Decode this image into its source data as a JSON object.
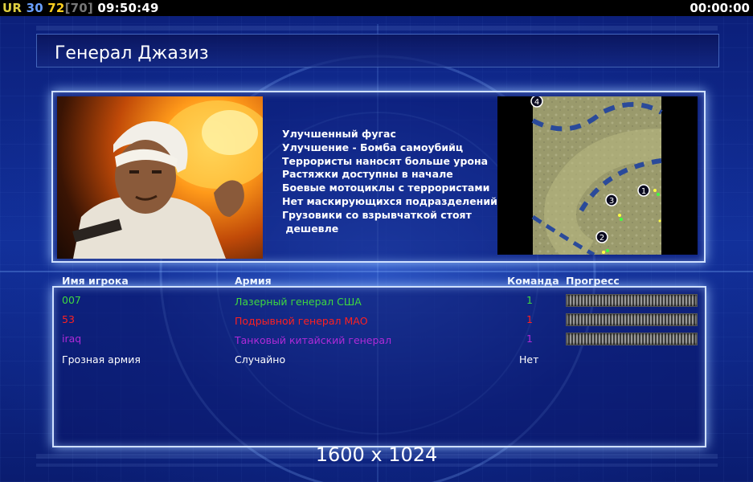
{
  "status_bar": {
    "ur": "UR",
    "ping": "30",
    "fps": "72",
    "fps_cap": "[70]",
    "clock": "09:50:49",
    "timer": "00:00:00"
  },
  "general": {
    "name": "Генерал Джазиз",
    "bonuses": [
      "Улучшенный фугас",
      "Улучшение - Бомба самоубийц",
      "Террористы наносят больше урона",
      "Растяжки доступны в начале",
      "Боевые мотоциклы с террористами",
      "Нет маскирующихся подразделений",
      "Грузовики со взрывчаткой стоят",
      " дешевле"
    ]
  },
  "minimap": {
    "markers": [
      "4",
      "1",
      "3",
      "2"
    ]
  },
  "table": {
    "headers": {
      "player": "Имя игрока",
      "army": "Армия",
      "team": "Команда",
      "progress": "Прогресс"
    },
    "rows": [
      {
        "player": "007",
        "army": "Лазерный генерал США",
        "team": "1",
        "color": "#3fd83f",
        "progress": 0
      },
      {
        "player": "53",
        "army": "Подрывной генерал МАО",
        "team": "1",
        "color": "#ff2020",
        "progress": 0
      },
      {
        "player": "iraq",
        "army": "Танковый китайский генерал",
        "team": "1",
        "color": "#b02ad8",
        "progress": 0
      },
      {
        "player": "Грозная армия",
        "army": "Случайно",
        "team": "Нет",
        "color": "#ffffff",
        "progress": null
      }
    ]
  },
  "resolution": "1600 x 1024"
}
